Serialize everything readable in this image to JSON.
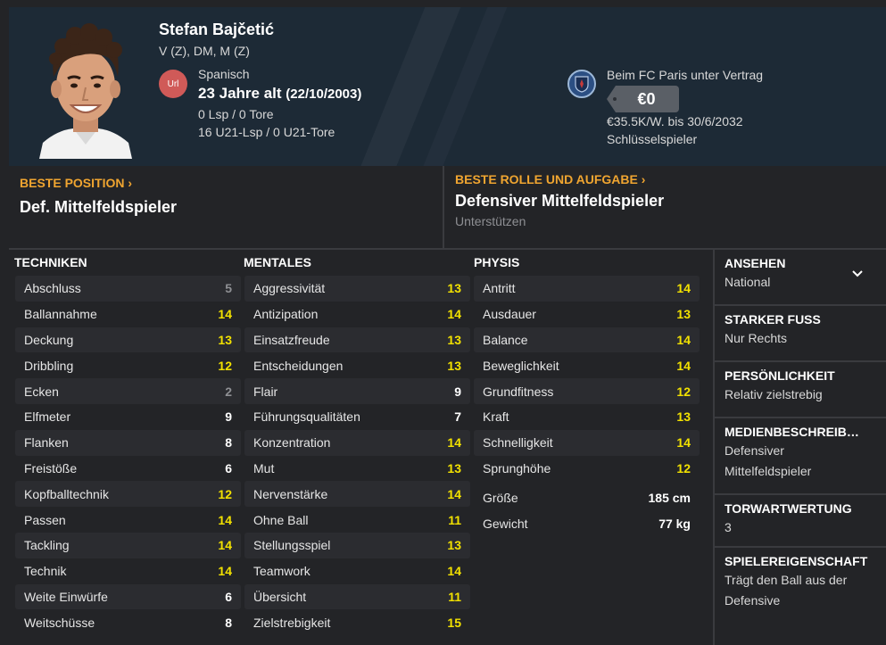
{
  "player": {
    "name": "Stefan Bajčetić",
    "positions": "V (Z), DM, M (Z)",
    "nationality_badge": "Url",
    "nationality": "Spanisch",
    "age": "23 Jahre alt",
    "dob": "(22/10/2003)",
    "caps": "0 Lsp / 0 Tore",
    "u21_caps": "16 U21-Lsp / 0 U21-Tore"
  },
  "contract": {
    "club_text": "Beim FC Paris unter Vertrag",
    "value": "€0",
    "wage": "€35.5K/W. bis 30/6/2032",
    "status": "Schlüsselspieler"
  },
  "best_position": {
    "label": "BESTE POSITION",
    "value": "Def. Mittelfeldspieler"
  },
  "best_role": {
    "label": "BESTE ROLLE UND AUFGABE",
    "value": "Defensiver Mittelfeldspieler",
    "duty": "Unterstützen"
  },
  "columns": {
    "technical": {
      "title": "TECHNIKEN",
      "attrs": [
        {
          "name": "Abschluss",
          "value": "5"
        },
        {
          "name": "Ballannahme",
          "value": "14"
        },
        {
          "name": "Deckung",
          "value": "13"
        },
        {
          "name": "Dribbling",
          "value": "12"
        },
        {
          "name": "Ecken",
          "value": "2"
        },
        {
          "name": "Elfmeter",
          "value": "9"
        },
        {
          "name": "Flanken",
          "value": "8"
        },
        {
          "name": "Freistöße",
          "value": "6"
        },
        {
          "name": "Kopfballtechnik",
          "value": "12"
        },
        {
          "name": "Passen",
          "value": "14"
        },
        {
          "name": "Tackling",
          "value": "14"
        },
        {
          "name": "Technik",
          "value": "14"
        },
        {
          "name": "Weite Einwürfe",
          "value": "6"
        },
        {
          "name": "Weitschüsse",
          "value": "8"
        }
      ]
    },
    "mental": {
      "title": "MENTALES",
      "attrs": [
        {
          "name": "Aggressivität",
          "value": "13"
        },
        {
          "name": "Antizipation",
          "value": "14"
        },
        {
          "name": "Einsatzfreude",
          "value": "13"
        },
        {
          "name": "Entscheidungen",
          "value": "13"
        },
        {
          "name": "Flair",
          "value": "9"
        },
        {
          "name": "Führungsqualitäten",
          "value": "7"
        },
        {
          "name": "Konzentration",
          "value": "14"
        },
        {
          "name": "Mut",
          "value": "13"
        },
        {
          "name": "Nervenstärke",
          "value": "14"
        },
        {
          "name": "Ohne Ball",
          "value": "11"
        },
        {
          "name": "Stellungsspiel",
          "value": "13"
        },
        {
          "name": "Teamwork",
          "value": "14"
        },
        {
          "name": "Übersicht",
          "value": "11"
        },
        {
          "name": "Zielstrebigkeit",
          "value": "15"
        }
      ]
    },
    "physical": {
      "title": "PHYSIS",
      "attrs": [
        {
          "name": "Antritt",
          "value": "14"
        },
        {
          "name": "Ausdauer",
          "value": "13"
        },
        {
          "name": "Balance",
          "value": "14"
        },
        {
          "name": "Beweglichkeit",
          "value": "14"
        },
        {
          "name": "Grundfitness",
          "value": "12"
        },
        {
          "name": "Kraft",
          "value": "13"
        },
        {
          "name": "Schnelligkeit",
          "value": "14"
        },
        {
          "name": "Sprunghöhe",
          "value": "12"
        }
      ],
      "height_label": "Größe",
      "height_value": "185 cm",
      "weight_label": "Gewicht",
      "weight_value": "77 kg"
    }
  },
  "info": {
    "reputation_title": "ANSEHEN",
    "reputation_value": "National",
    "foot_title": "STARKER FUSS",
    "foot_value": "Nur Rechts",
    "personality_title": "PERSÖNLICHKEIT",
    "personality_value": "Relativ zielstrebig",
    "media_title": "MEDIENBESCHREIB…",
    "media_value": "Defensiver Mittelfeldspieler",
    "gk_title": "TORWARTWERTUNG",
    "gk_value": "3",
    "trait_title": "SPIELEREIGENSCHAFT",
    "trait_value": "Trägt den Ball aus der Defensive"
  },
  "colors": {
    "accent": "#f0a530",
    "high_value": "#f2e100",
    "header_bg": "#1d2a36",
    "panel_bg": "#232427"
  },
  "icons": [
    "club-crest-icon",
    "chevron-right-icon",
    "chevron-down-icon",
    "player-photo"
  ]
}
